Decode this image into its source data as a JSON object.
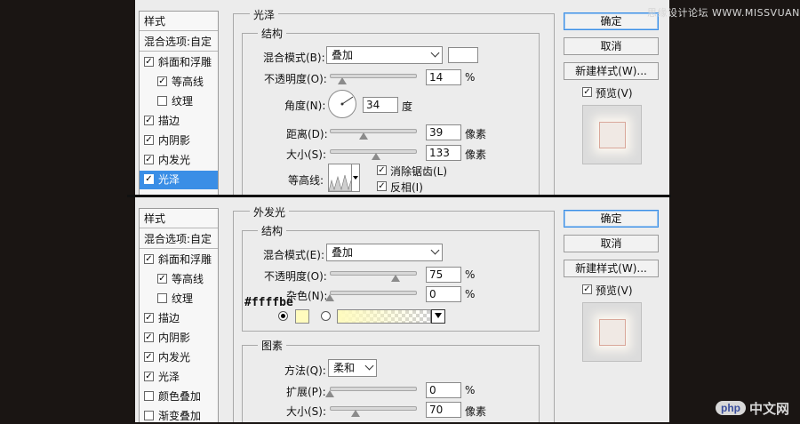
{
  "watermark": "思缘设计论坛 WWW.MISSVUAN.COM",
  "logo": {
    "badge": "php",
    "text": "中文网"
  },
  "annotation": {
    "hex": "#ffffbe"
  },
  "colors": {
    "selected": "#3a8ee6",
    "glow": "#fffbbe"
  },
  "dialog_top": {
    "style_list": {
      "header": "样式",
      "blend_options": "混合选项:自定",
      "items": [
        {
          "label": "斜面和浮雕",
          "checked": true,
          "indent": false
        },
        {
          "label": "等高线",
          "checked": true,
          "indent": true
        },
        {
          "label": "纹理",
          "checked": false,
          "indent": true
        },
        {
          "label": "描边",
          "checked": true,
          "indent": false
        },
        {
          "label": "内阴影",
          "checked": true,
          "indent": false
        },
        {
          "label": "内发光",
          "checked": true,
          "indent": false
        },
        {
          "label": "光泽",
          "checked": true,
          "indent": false,
          "selected": true
        }
      ]
    },
    "section_title": "光泽",
    "group_title": "结构",
    "blend_mode": {
      "label": "混合模式(B):",
      "value": "叠加"
    },
    "opacity": {
      "label": "不透明度(O):",
      "value": "14",
      "unit": "%",
      "level": 0.14
    },
    "angle": {
      "label": "角度(N):",
      "value": "34",
      "unit": "度"
    },
    "distance": {
      "label": "距离(D):",
      "value": "39",
      "unit": "像素",
      "level": 0.39
    },
    "size": {
      "label": "大小(S):",
      "value": "133",
      "unit": "像素",
      "level": 0.53
    },
    "contour": {
      "label": "等高线:"
    },
    "antialias": {
      "label": "消除锯齿(L)",
      "checked": true
    },
    "invert": {
      "label": "反相(I)",
      "checked": true
    },
    "buttons": {
      "ok": "确定",
      "cancel": "取消",
      "new_style": "新建样式(W)..."
    },
    "preview": {
      "label": "预览(V)",
      "checked": true
    }
  },
  "dialog_bottom": {
    "style_list": {
      "header": "样式",
      "blend_options": "混合选项:自定",
      "items": [
        {
          "label": "斜面和浮雕",
          "checked": true,
          "indent": false
        },
        {
          "label": "等高线",
          "checked": true,
          "indent": true
        },
        {
          "label": "纹理",
          "checked": false,
          "indent": true
        },
        {
          "label": "描边",
          "checked": true,
          "indent": false
        },
        {
          "label": "内阴影",
          "checked": true,
          "indent": false
        },
        {
          "label": "内发光",
          "checked": true,
          "indent": false
        },
        {
          "label": "光泽",
          "checked": true,
          "indent": false
        },
        {
          "label": "颜色叠加",
          "checked": false,
          "indent": false
        },
        {
          "label": "渐变叠加",
          "checked": false,
          "indent": false
        }
      ]
    },
    "section_title": "外发光",
    "group_structure": "结构",
    "blend_mode": {
      "label": "混合模式(E):",
      "value": "叠加"
    },
    "opacity": {
      "label": "不透明度(O):",
      "value": "75",
      "unit": "%",
      "level": 0.75
    },
    "noise": {
      "label": "杂色(N):",
      "value": "0",
      "unit": "%",
      "level": 0
    },
    "group_elements": "图素",
    "method": {
      "label": "方法(Q):",
      "value": "柔和"
    },
    "spread": {
      "label": "扩展(P):",
      "value": "0",
      "unit": "%",
      "level": 0
    },
    "size": {
      "label": "大小(S):",
      "value": "70",
      "unit": "像素",
      "level": 0.3
    },
    "buttons": {
      "ok": "确定",
      "cancel": "取消",
      "new_style": "新建样式(W)..."
    },
    "preview": {
      "label": "预览(V)",
      "checked": true
    }
  }
}
